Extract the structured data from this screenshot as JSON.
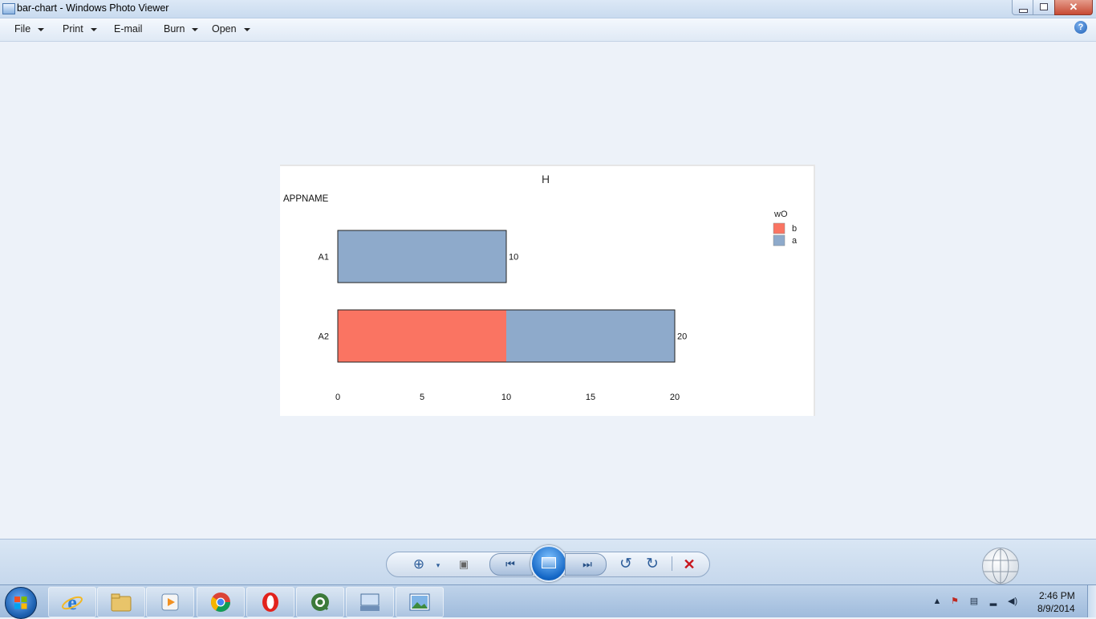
{
  "window": {
    "title": "bar-chart - Windows Photo Viewer",
    "buttons": {
      "minimize": "–",
      "maximize": "❐",
      "close": "✕"
    }
  },
  "menu": {
    "items": [
      {
        "label": "File",
        "dropdown": true
      },
      {
        "label": "Print",
        "dropdown": true
      },
      {
        "label": "E-mail",
        "dropdown": false
      },
      {
        "label": "Burn",
        "dropdown": true
      },
      {
        "label": "Open",
        "dropdown": true
      }
    ],
    "help": "?"
  },
  "chart_data": {
    "type": "bar",
    "orientation": "horizontal",
    "stacked": true,
    "title": "H",
    "category_axis_label": "APPNAME",
    "categories": [
      "A1",
      "A2"
    ],
    "series": [
      {
        "name": "b",
        "color": "#fa7462",
        "values": [
          0,
          10
        ]
      },
      {
        "name": "a",
        "color": "#8eaacb",
        "values": [
          10,
          10
        ]
      }
    ],
    "totals": [
      "10",
      "20"
    ],
    "x_ticks": [
      "0",
      "5",
      "10",
      "15",
      "20"
    ],
    "xlim": [
      0,
      20
    ],
    "legend": {
      "title": "wO",
      "entries": [
        "b",
        "a"
      ],
      "placement": "top-right"
    },
    "grid": false
  },
  "controls": {
    "icons": [
      "zoom-icon",
      "actual-size-icon",
      "previous-icon",
      "slideshow-icon",
      "next-icon",
      "rotate-ccw-icon",
      "rotate-cw-icon",
      "delete-icon"
    ],
    "zoom": "⊕",
    "fit": "▣",
    "prev": "⏮",
    "next": "⏭",
    "rotate_ccw": "↺",
    "rotate_cw": "↻",
    "delete": "✕"
  },
  "taskbar": {
    "apps": [
      "internet-explorer",
      "file-explorer",
      "media-player",
      "chrome",
      "opera",
      "qlikview",
      "keyboard-app",
      "photo-viewer"
    ],
    "time": "2:46 PM",
    "date": "8/9/2014",
    "tray_icons": [
      "show-hidden-icon",
      "action-center-icon",
      "device-icon",
      "network-icon",
      "volume-icon"
    ]
  },
  "colors": {
    "accent": "#1f5fb5",
    "viewer_bg": "#edf2f9",
    "bar_b": "#fa7462",
    "bar_a": "#8eaacb"
  }
}
